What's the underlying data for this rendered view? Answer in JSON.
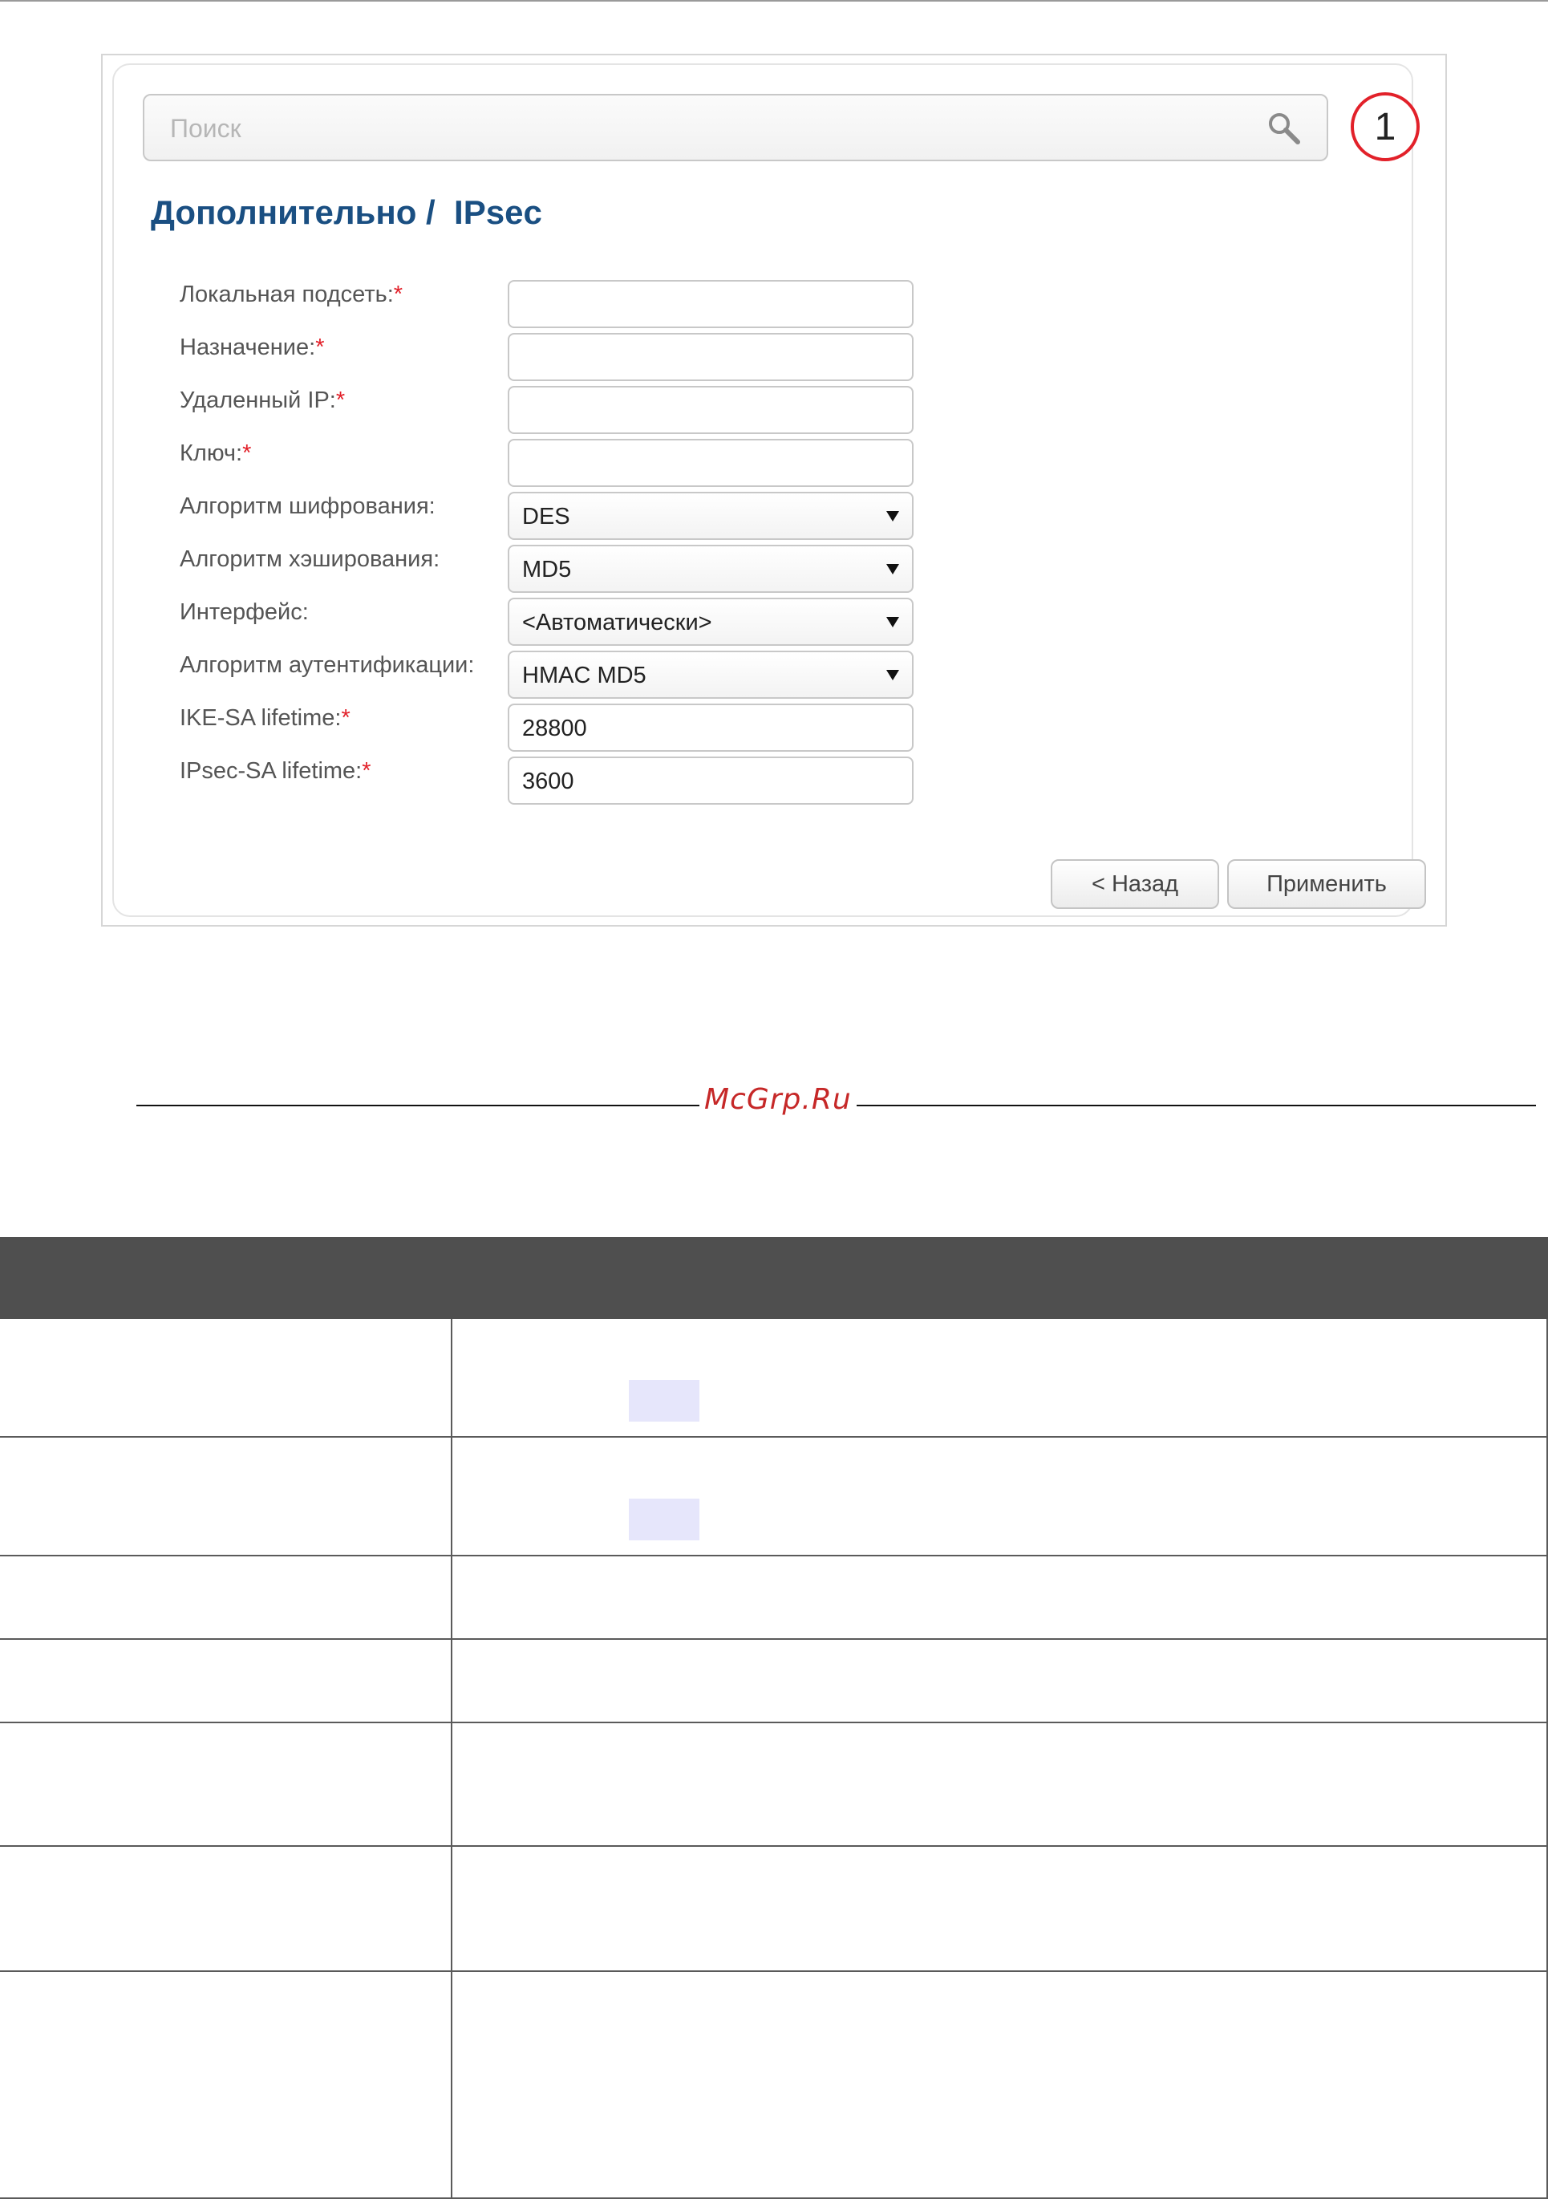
{
  "search": {
    "placeholder": "Поиск"
  },
  "step_badge": "1",
  "page_title": "Дополнительно /  IPsec",
  "form": {
    "fields": [
      {
        "label": "Локальная подсеть:",
        "required": true,
        "type": "text",
        "value": ""
      },
      {
        "label": "Назначение:",
        "required": true,
        "type": "text",
        "value": ""
      },
      {
        "label": "Удаленный IP:",
        "required": true,
        "type": "text",
        "value": ""
      },
      {
        "label": "Ключ:",
        "required": true,
        "type": "text",
        "value": ""
      },
      {
        "label": "Алгоритм шифрования:",
        "required": false,
        "type": "select",
        "value": "DES"
      },
      {
        "label": "Алгоритм хэширования:",
        "required": false,
        "type": "select",
        "value": "MD5"
      },
      {
        "label": "Интерфейс:",
        "required": false,
        "type": "select",
        "value": "<Автоматически>"
      },
      {
        "label": "Алгоритм аутентификации:",
        "required": false,
        "type": "select",
        "value": "HMAC MD5"
      },
      {
        "label": "IKE-SA lifetime:",
        "required": true,
        "type": "text",
        "value": "28800"
      },
      {
        "label": "IPsec-SA lifetime:",
        "required": true,
        "type": "text",
        "value": "3600"
      }
    ],
    "buttons": {
      "back": "< Назад",
      "apply": "Применить"
    }
  },
  "watermark": "McGrp.Ru",
  "colors": {
    "title": "#1a4f82",
    "required_marker": "#e2212a",
    "table_header": "#4f4f4f",
    "highlight": "#e6e6fb"
  }
}
